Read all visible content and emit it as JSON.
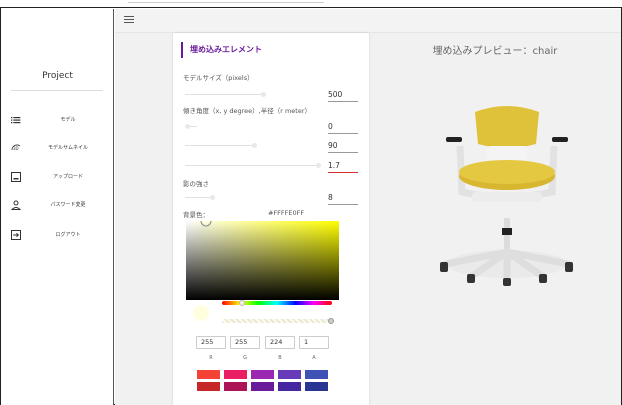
{
  "sidebar": {
    "project_label": "Project",
    "items": [
      {
        "label": "モデル",
        "icon": "list-icon"
      },
      {
        "label": "モデルサムネイル",
        "icon": "3d-rotation-icon"
      },
      {
        "label": "アップロード",
        "icon": "image-upload-icon"
      },
      {
        "label": "パスワード変更",
        "icon": "person-icon"
      },
      {
        "label": "ログアウト",
        "icon": "logout-icon"
      }
    ]
  },
  "topbar": {
    "menu_icon": "hamburger-icon"
  },
  "panel": {
    "title": "埋め込みエレメント",
    "model_size_label": "モデルサイズ（pixels）",
    "model_size_value": "500",
    "angle_label": "傾き角度（x, y degree）,半径（r meter）",
    "angle_x": "0",
    "angle_y": "90",
    "radius": "1.7",
    "shadow_label": "影の強さ",
    "shadow_value": "8",
    "bgcolor_label": "背景色：",
    "bgcolor_value": "#FFFFE0FF",
    "rgba": {
      "r": "255",
      "g": "255",
      "b": "224",
      "a": "1",
      "r_label": "R",
      "g_label": "G",
      "b_label": "B",
      "a_label": "A"
    },
    "swatches_row1": [
      "#f44336",
      "#e91e63",
      "#9c27b0",
      "#673ab7",
      "#3f51b5"
    ],
    "swatches_row2": [
      "#c62828",
      "#ad1457",
      "#6a1b9a",
      "#4527a0",
      "#283593"
    ]
  },
  "preview": {
    "title": "埋め込みプレビュー：chair"
  },
  "colors": {
    "accent": "#6a1b9a",
    "picked": "#FFFFE0",
    "seat": "#e0c23a"
  }
}
